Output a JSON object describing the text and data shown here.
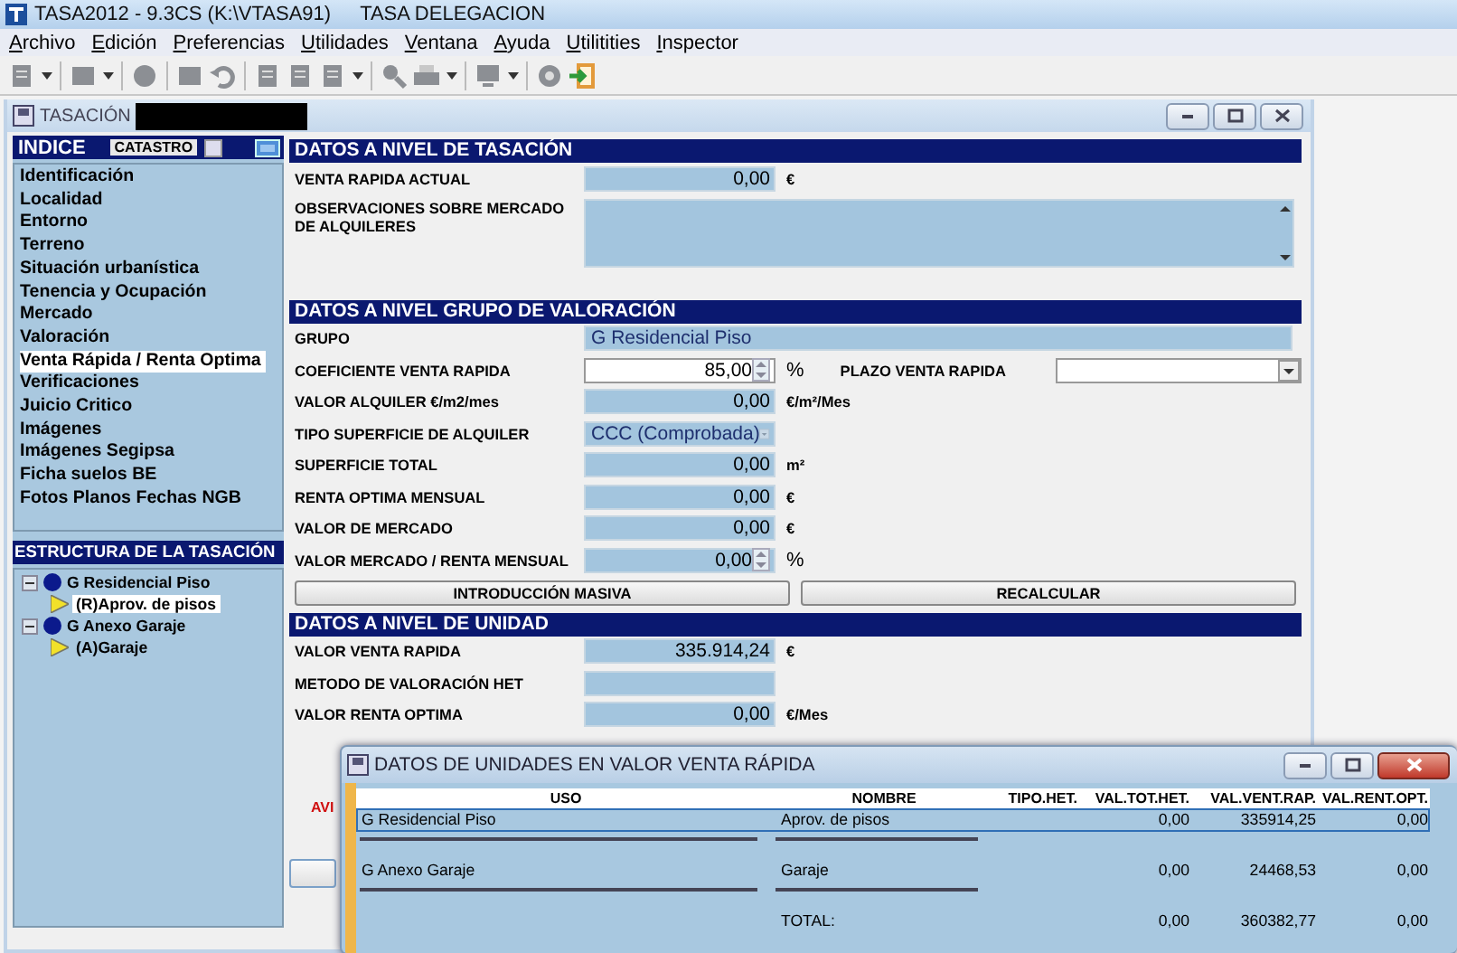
{
  "app": {
    "title": "TASA2012 - 9.3CS (K:\\VTASA91)",
    "context": "TASA DELEGACION"
  },
  "menu": [
    {
      "label": "Archivo"
    },
    {
      "label": "Edición"
    },
    {
      "label": "Preferencias"
    },
    {
      "label": "Utilidades"
    },
    {
      "label": "Ventana"
    },
    {
      "label": "Ayuda"
    },
    {
      "label": "Utilitities"
    },
    {
      "label": "Inspector"
    }
  ],
  "window": {
    "title": "TASACIÓN"
  },
  "index": {
    "title": "INDICE",
    "catastro_label": "CATASTRO",
    "catastro_checked": false,
    "items": [
      {
        "label": "Identificación",
        "selected": false
      },
      {
        "label": "Localidad",
        "selected": false
      },
      {
        "label": "Entorno",
        "selected": false
      },
      {
        "label": "Terreno",
        "selected": false
      },
      {
        "label": "Situación urbanística",
        "selected": false
      },
      {
        "label": "Tenencia y Ocupación",
        "selected": false
      },
      {
        "label": "Mercado",
        "selected": false
      },
      {
        "label": "Valoración",
        "selected": false
      },
      {
        "label": "Venta Rápida / Renta Optima",
        "selected": true
      },
      {
        "label": "Verificaciones",
        "selected": false
      },
      {
        "label": "Juicio Critico",
        "selected": false
      },
      {
        "label": "Imágenes",
        "selected": false
      },
      {
        "label": "Imágenes Segipsa",
        "selected": false
      },
      {
        "label": "Ficha suelos BE",
        "selected": false
      },
      {
        "label": "Fotos Planos Fechas NGB",
        "selected": false
      }
    ]
  },
  "structure": {
    "title": "ESTRUCTURA DE LA TASACIÓN",
    "tree": [
      {
        "label": "G Residencial Piso",
        "expanded": true,
        "children": [
          {
            "label": "(R)Aprov. de pisos",
            "selected": true
          }
        ]
      },
      {
        "label": "G Anexo Garaje",
        "expanded": true,
        "children": [
          {
            "label": "(A)Garaje",
            "selected": false
          }
        ]
      }
    ]
  },
  "sections": [
    {
      "title": "DATOS A NIVEL DE TASACIÓN",
      "rows": [
        {
          "kind": "number",
          "label": "VENTA RAPIDA ACTUAL",
          "value": "0,00",
          "unit": "€"
        },
        {
          "kind": "memo",
          "label": "OBSERVACIONES SOBRE MERCADO DE ALQUILERES"
        }
      ]
    },
    {
      "title": "DATOS A NIVEL GRUPO DE VALORACIÓN",
      "rows": [
        {
          "kind": "text",
          "label": "GRUPO",
          "value": "G Residencial Piso"
        },
        {
          "kind": "spin",
          "label": "COEFICIENTE VENTA RAPIDA",
          "value": "85,00",
          "unit": "%",
          "editable": true,
          "side_label": "PLAZO VENTA RAPIDA"
        },
        {
          "kind": "number",
          "label": "VALOR ALQUILER €/m2/mes",
          "value": "0,00",
          "unit": "€/m²/Mes"
        },
        {
          "kind": "combo",
          "label": "TIPO SUPERFICIE DE ALQUILER",
          "value": "CCC (Comprobada)"
        },
        {
          "kind": "number",
          "label": "SUPERFICIE TOTAL",
          "value": "0,00",
          "unit": "m²"
        },
        {
          "kind": "number",
          "label": "RENTA OPTIMA MENSUAL",
          "value": "0,00",
          "unit": "€"
        },
        {
          "kind": "number",
          "label": "VALOR DE MERCADO",
          "value": "0,00",
          "unit": "€"
        },
        {
          "kind": "spin",
          "label": "VALOR MERCADO / RENTA MENSUAL",
          "value": "0,00",
          "unit": "%",
          "editable": false
        },
        {
          "kind": "buttons",
          "buttons": [
            "INTRODUCCIÓN MASIVA",
            "RECALCULAR"
          ]
        }
      ]
    },
    {
      "title": "DATOS A NIVEL DE UNIDAD",
      "rows": [
        {
          "kind": "number",
          "label": "VALOR VENTA RAPIDA",
          "value": "335.914,24",
          "unit": "€"
        },
        {
          "kind": "number",
          "label": "METODO DE VALORACIÓN HET"
        },
        {
          "kind": "number",
          "label": "VALOR RENTA OPTIMA",
          "value": "0,00",
          "unit": "€/Mes"
        }
      ]
    }
  ],
  "warning": "AVI",
  "dialog": {
    "title": "DATOS DE UNIDADES EN VALOR VENTA RÁPIDA",
    "columns": [
      "USO",
      "NOMBRE",
      "TIPO.HET.",
      "VAL.TOT.HET.",
      "VAL.VENT.RAP.",
      "VAL.RENT.OPT."
    ],
    "rows": [
      {
        "kind": "unit",
        "selected": true,
        "uso": "G Residencial Piso",
        "nombre": "Aprov. de pisos",
        "val_tot_het": "0,00",
        "val_vent_rap": "335914,25",
        "val_rent_opt": "0,00"
      },
      {
        "kind": "unit",
        "selected": false,
        "uso": "G Anexo Garaje",
        "nombre": "Garaje",
        "val_tot_het": "0,00",
        "val_vent_rap": "24468,53",
        "val_rent_opt": "0,00"
      },
      {
        "kind": "total",
        "selected": false,
        "nombre": "TOTAL:",
        "val_tot_het": "0,00",
        "val_vent_rap": "360382,77",
        "val_rent_opt": "0,00"
      }
    ]
  }
}
